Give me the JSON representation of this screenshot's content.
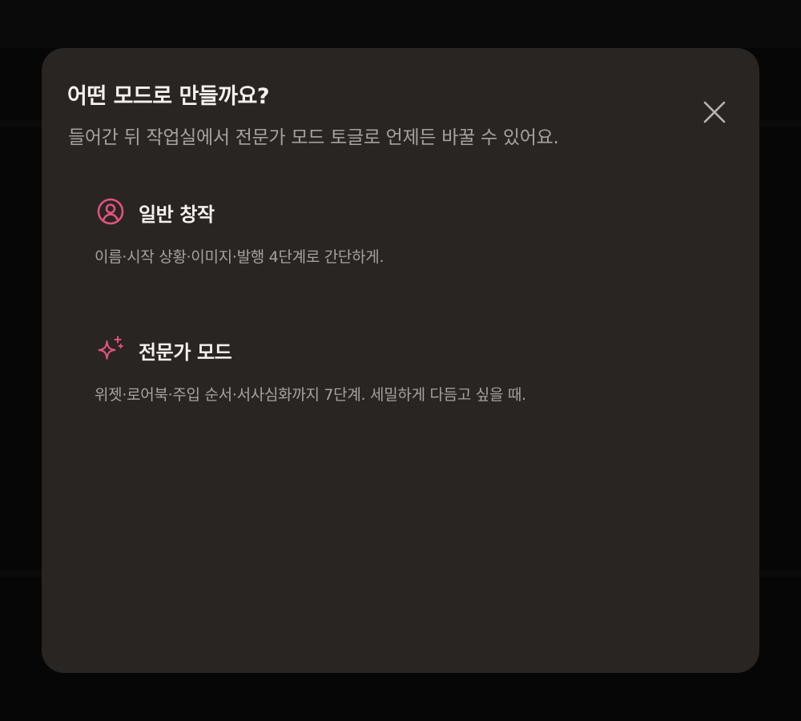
{
  "colors": {
    "modal_background": "#292523",
    "accent": "#e0527f",
    "title_text": "#f4f1ee",
    "secondary_text": "#a8a29d",
    "close_icon": "#b9b3ae"
  },
  "dialog": {
    "title": "어떤 모드로 만들까요?",
    "subtitle": "들어간 뒤 작업실에서 전문가 모드 토글로 언제든 바꿀 수 있어요.",
    "close_icon": "close-icon"
  },
  "modes": [
    {
      "icon": "user-circle-icon",
      "name": "일반 창작",
      "description": "이름·시작 상황·이미지·발행 4단계로 간단하게."
    },
    {
      "icon": "sparkles-icon",
      "name": "전문가 모드",
      "description": "위젯·로어북·주입 순서·서사심화까지 7단계. 세밀하게 다듬고 싶을 때."
    }
  ]
}
